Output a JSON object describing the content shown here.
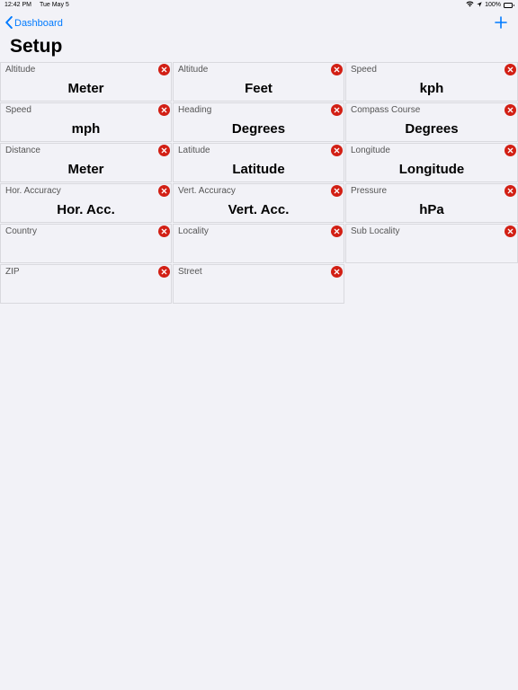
{
  "status_bar": {
    "time": "12:42 PM",
    "date": "Tue May 5",
    "battery": "100%",
    "icons": [
      "wifi-icon",
      "location-arrow-icon",
      "battery-icon"
    ]
  },
  "nav": {
    "back_label": "Dashboard",
    "add_icon": "plus-icon"
  },
  "title": "Setup",
  "colors": {
    "accent": "#007aff",
    "delete": "#d21f14",
    "background": "#f2f2f7"
  },
  "tiles": [
    {
      "label": "Altitude",
      "value": "Meter"
    },
    {
      "label": "Altitude",
      "value": "Feet"
    },
    {
      "label": "Speed",
      "value": "kph"
    },
    {
      "label": "Speed",
      "value": "mph"
    },
    {
      "label": "Heading",
      "value": "Degrees"
    },
    {
      "label": "Compass Course",
      "value": "Degrees"
    },
    {
      "label": "Distance",
      "value": "Meter"
    },
    {
      "label": "Latitude",
      "value": "Latitude"
    },
    {
      "label": "Longitude",
      "value": "Longitude"
    },
    {
      "label": "Hor. Accuracy",
      "value": "Hor. Acc."
    },
    {
      "label": "Vert. Accuracy",
      "value": "Vert. Acc."
    },
    {
      "label": "Pressure",
      "value": "hPa"
    },
    {
      "label": "Country",
      "value": ""
    },
    {
      "label": "Locality",
      "value": ""
    },
    {
      "label": "Sub Locality",
      "value": ""
    },
    {
      "label": "ZIP",
      "value": ""
    },
    {
      "label": "Street",
      "value": ""
    }
  ]
}
